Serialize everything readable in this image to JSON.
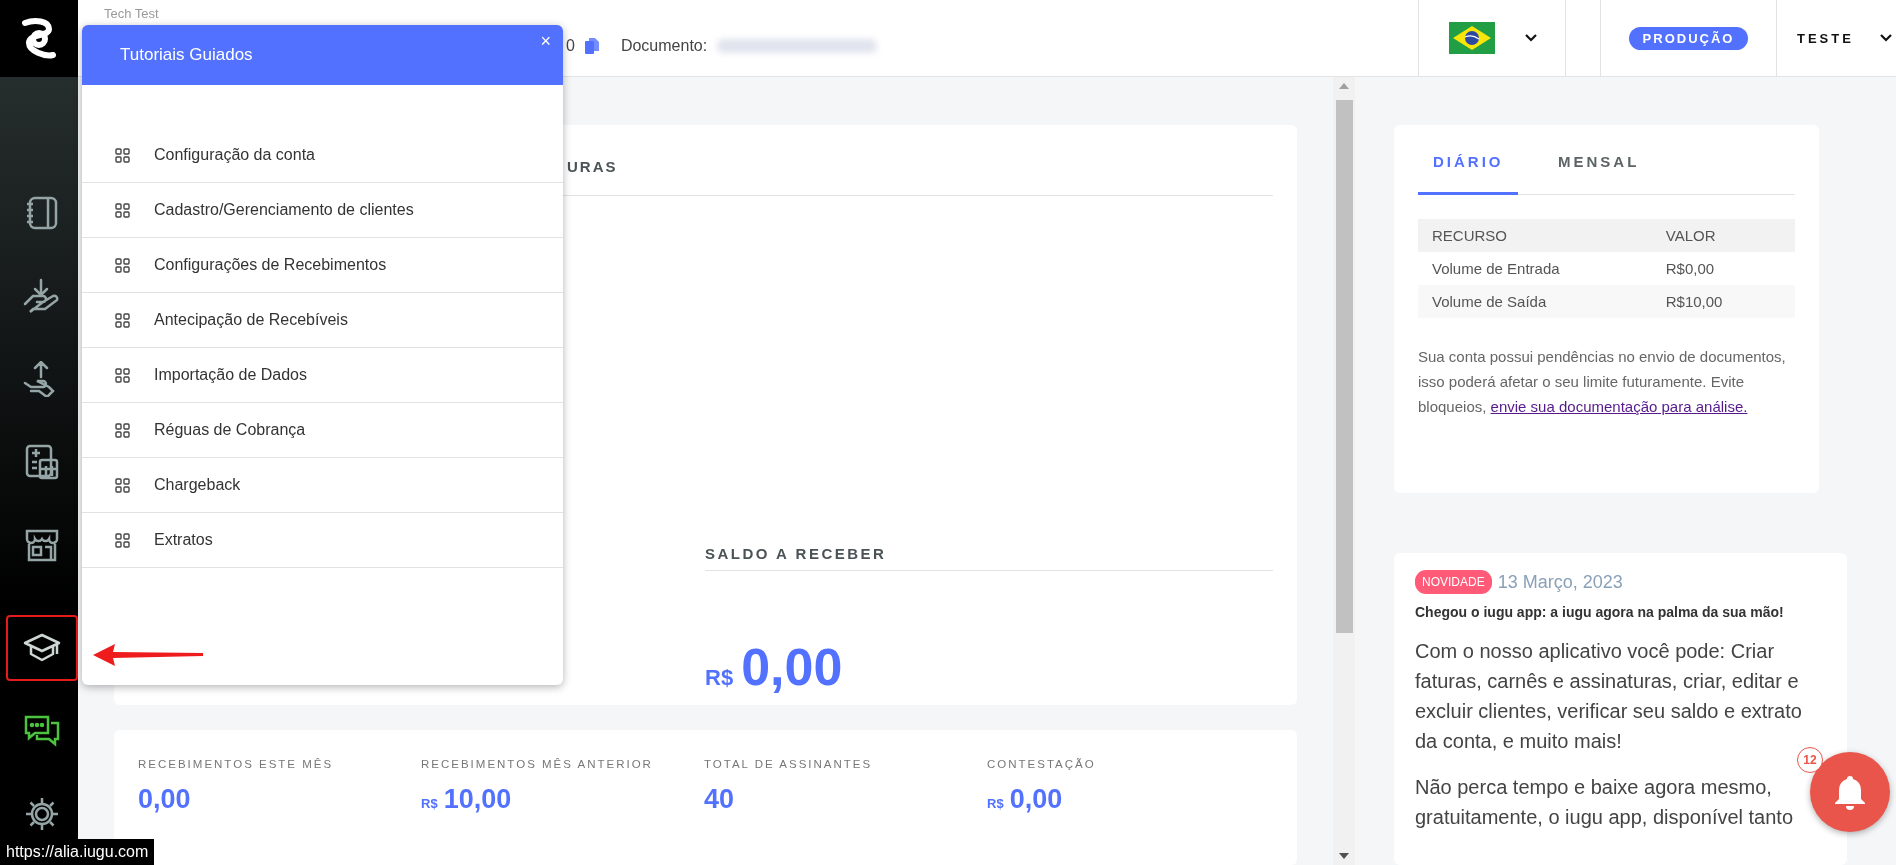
{
  "sidebar": {
    "items": [
      {
        "kind": "notebook",
        "highlighted": false
      },
      {
        "kind": "hand-receive",
        "highlighted": false
      },
      {
        "kind": "hand-send",
        "highlighted": false
      },
      {
        "kind": "calculator",
        "highlighted": false
      },
      {
        "kind": "store",
        "highlighted": false
      },
      {
        "kind": "graduation",
        "highlighted": true
      },
      {
        "kind": "chat",
        "highlighted": false
      },
      {
        "kind": "settings",
        "highlighted": false
      }
    ]
  },
  "topbar": {
    "account": "Tech Test",
    "code_tail": "0",
    "document_label": "Documento:",
    "environment": "PRODUÇÃO",
    "user": "TESTE"
  },
  "tutorial_popup": {
    "title": "Tutoriais Guiados",
    "close": "×",
    "items": [
      "Configuração da conta",
      "Cadastro/Gerenciamento de clientes",
      "Configurações de Recebimentos",
      "Antecipação de Recebíveis",
      "Importação de Dados",
      "Réguas de Cobrança",
      "Chargeback",
      "Extratos"
    ]
  },
  "balance_card": {
    "tab_fragment": "URAS",
    "receivable": {
      "label": "SALDO A RECEBER",
      "currency": "R$",
      "amount": "0,00"
    }
  },
  "stats": [
    {
      "label": "RECEBIMENTOS ESTE MÊS",
      "amount": "0,00"
    },
    {
      "label": "RECEBIMENTOS MÊS ANTERIOR",
      "currency": "R$",
      "amount": "10,00"
    },
    {
      "label": "TOTAL DE ASSINANTES",
      "amount": "40"
    },
    {
      "label": "CONTESTAÇÃO",
      "currency": "R$",
      "amount": "0,00"
    }
  ],
  "limits_card": {
    "tabs": [
      {
        "label": "DIÁRIO",
        "selected": true
      },
      {
        "label": "MENSAL",
        "selected": false
      }
    ],
    "table": {
      "columns": [
        "RECURSO",
        "VALOR"
      ],
      "rows": [
        [
          "Volume de Entrada",
          "R$0,00"
        ],
        [
          "Volume de Saída",
          "R$10,00"
        ]
      ]
    },
    "notice": {
      "text": "Sua conta possui pendências no envio de documentos, isso poderá afetar o seu limite futuramente. Evite bloqueios,",
      "link": "envie sua documentação para análise."
    }
  },
  "news": {
    "badge": "NOVIDADE",
    "date": "13 Março, 2023",
    "title": "Chegou o iugu app: a iugu agora na palma da sua mão!",
    "paragraphs": [
      "Com o nosso aplicativo você pode: Criar faturas, carnês e assinaturas, criar, editar e excluir clientes, verificar seu saldo e extrato da conta, e muito mais!",
      "Não perca tempo e baixe agora mesmo, gratuitamente, o iugu app, disponível tanto"
    ]
  },
  "notifications": {
    "count": "12"
  },
  "status_url": "https://alia.iugu.com"
}
